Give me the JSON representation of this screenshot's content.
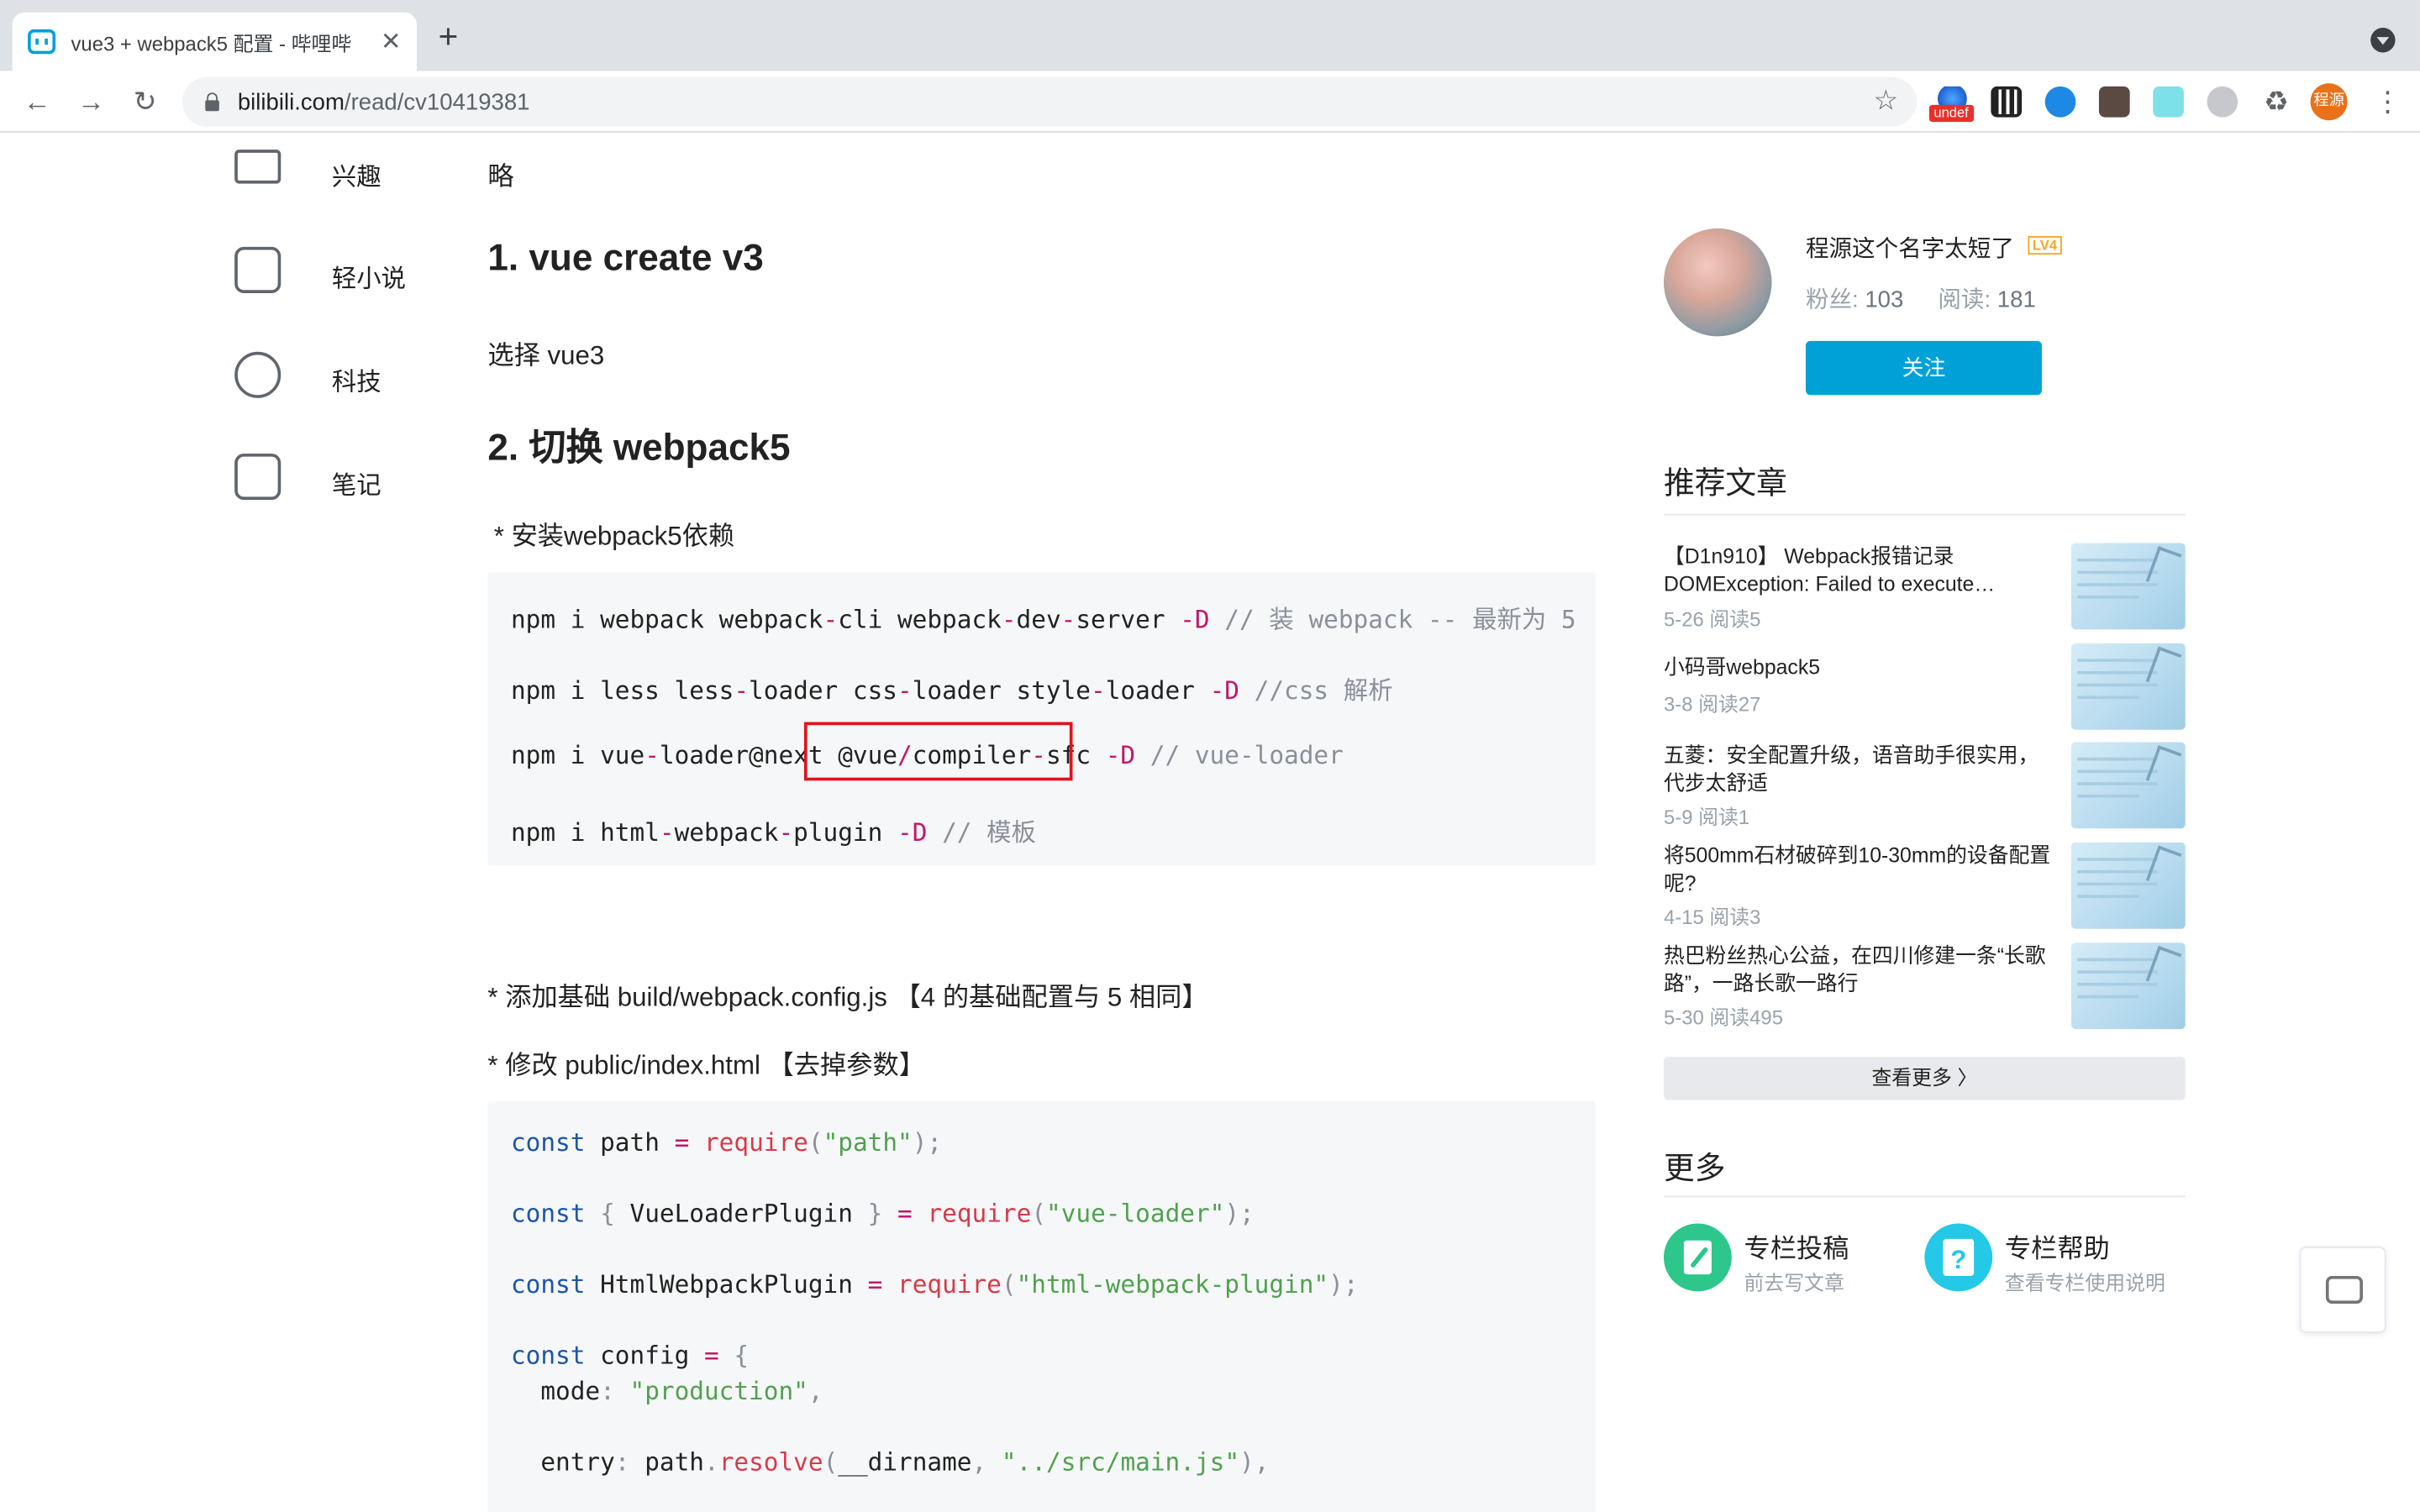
{
  "browser": {
    "tab_title": "vue3 + webpack5 配置 - 哔哩哔",
    "tab_close": "✕",
    "new_tab": "+",
    "url_host": "bilibili.com",
    "url_path": "/read/cv10419381",
    "ext_undef_label": "undef",
    "profile_label": "程源"
  },
  "left_nav": {
    "items": [
      {
        "label": "兴趣",
        "icon": "easel-icon"
      },
      {
        "label": "轻小说",
        "icon": "book-icon"
      },
      {
        "label": "科技",
        "icon": "planet-icon"
      },
      {
        "label": "笔记",
        "icon": "edit-note-icon"
      }
    ]
  },
  "article": {
    "lue": "略",
    "h_create": "1. vue create v3",
    "choose_vue3": "选择 vue3",
    "h_switch": "2. 切换 webpack5",
    "bullet_install": "*  安装webpack5依赖",
    "code1": [
      {
        "parts": [
          {
            "t": "npm i webpack webpack",
            "c": ""
          },
          {
            "t": "-",
            "c": "op"
          },
          {
            "t": "cli webpack",
            "c": ""
          },
          {
            "t": "-",
            "c": "op"
          },
          {
            "t": "dev",
            "c": ""
          },
          {
            "t": "-",
            "c": "op"
          },
          {
            "t": "server ",
            "c": ""
          },
          {
            "t": "-D",
            "c": "op"
          },
          {
            "t": " // 装 webpack -- 最新为 5",
            "c": "cm"
          }
        ]
      },
      {
        "parts": [
          {
            "t": "npm i less less",
            "c": ""
          },
          {
            "t": "-",
            "c": "op"
          },
          {
            "t": "loader css",
            "c": ""
          },
          {
            "t": "-",
            "c": "op"
          },
          {
            "t": "loader style",
            "c": ""
          },
          {
            "t": "-",
            "c": "op"
          },
          {
            "t": "loader ",
            "c": ""
          },
          {
            "t": "-D",
            "c": "op"
          },
          {
            "t": " //css 解析",
            "c": "cm"
          }
        ]
      },
      {
        "parts": [
          {
            "t": "npm i vue",
            "c": ""
          },
          {
            "t": "-",
            "c": "op"
          },
          {
            "t": "loader@next ",
            "c": ""
          },
          {
            "t": "@vue",
            "c": ""
          },
          {
            "t": "/",
            "c": "op"
          },
          {
            "t": "compiler",
            "c": ""
          },
          {
            "t": "-",
            "c": "op"
          },
          {
            "t": "sfc ",
            "c": ""
          },
          {
            "t": "-D",
            "c": "op"
          },
          {
            "t": " // vue-loader",
            "c": "cm"
          }
        ]
      },
      {
        "parts": [
          {
            "t": "npm i html",
            "c": ""
          },
          {
            "t": "-",
            "c": "op"
          },
          {
            "t": "webpack",
            "c": ""
          },
          {
            "t": "-",
            "c": "op"
          },
          {
            "t": "plugin ",
            "c": ""
          },
          {
            "t": "-D",
            "c": "op"
          },
          {
            "t": " // 模板",
            "c": "cm"
          }
        ]
      }
    ],
    "bullet_add_config": "*  添加基础 build/webpack.config.js 【4 的基础配置与 5 相同】",
    "bullet_modify_html": "*  修改 public/index.html 【去掉参数】",
    "code2": [
      {
        "parts": [
          {
            "t": "const",
            "c": "kw"
          },
          {
            "t": " path ",
            "c": ""
          },
          {
            "t": "=",
            "c": "op"
          },
          {
            "t": " ",
            "c": ""
          },
          {
            "t": "require",
            "c": "fn"
          },
          {
            "t": "(",
            "c": "pun"
          },
          {
            "t": "\"path\"",
            "c": "str"
          },
          {
            "t": ");",
            "c": "pun"
          }
        ]
      },
      {
        "parts": [
          {
            "t": "const",
            "c": "kw"
          },
          {
            "t": " ",
            "c": ""
          },
          {
            "t": "{",
            "c": "pun"
          },
          {
            "t": " VueLoaderPlugin ",
            "c": ""
          },
          {
            "t": "}",
            "c": "pun"
          },
          {
            "t": " ",
            "c": ""
          },
          {
            "t": "=",
            "c": "op"
          },
          {
            "t": " ",
            "c": ""
          },
          {
            "t": "require",
            "c": "fn"
          },
          {
            "t": "(",
            "c": "pun"
          },
          {
            "t": "\"vue-loader\"",
            "c": "str"
          },
          {
            "t": ");",
            "c": "pun"
          }
        ]
      },
      {
        "parts": [
          {
            "t": "const",
            "c": "kw"
          },
          {
            "t": " HtmlWebpackPlugin ",
            "c": ""
          },
          {
            "t": "=",
            "c": "op"
          },
          {
            "t": " ",
            "c": ""
          },
          {
            "t": "require",
            "c": "fn"
          },
          {
            "t": "(",
            "c": "pun"
          },
          {
            "t": "\"html-webpack-plugin\"",
            "c": "str"
          },
          {
            "t": ");",
            "c": "pun"
          }
        ]
      },
      {
        "parts": [
          {
            "t": "const",
            "c": "kw"
          },
          {
            "t": " config ",
            "c": ""
          },
          {
            "t": "=",
            "c": "op"
          },
          {
            "t": " ",
            "c": ""
          },
          {
            "t": "{",
            "c": "pun"
          }
        ]
      },
      {
        "parts": [
          {
            "t": "  mode",
            "c": ""
          },
          {
            "t": ":",
            "c": "pun"
          },
          {
            "t": " ",
            "c": ""
          },
          {
            "t": "\"production\"",
            "c": "str"
          },
          {
            "t": ",",
            "c": "pun"
          }
        ]
      },
      {
        "parts": [
          {
            "t": "  entry",
            "c": ""
          },
          {
            "t": ":",
            "c": "pun"
          },
          {
            "t": " path",
            "c": ""
          },
          {
            "t": ".",
            "c": "pun"
          },
          {
            "t": "resolve",
            "c": "fn"
          },
          {
            "t": "(",
            "c": "pun"
          },
          {
            "t": "__dirname",
            "c": ""
          },
          {
            "t": ",",
            "c": "pun"
          },
          {
            "t": " ",
            "c": ""
          },
          {
            "t": "\"../src/main.js\"",
            "c": "str"
          },
          {
            "t": "),",
            "c": "pun"
          }
        ]
      }
    ]
  },
  "author": {
    "name": "程源这个名字太短了",
    "level": "LV4",
    "fans_label": "粉丝:",
    "fans_value": "103",
    "reads_label": "阅读:",
    "reads_value": "181",
    "follow_label": "关注"
  },
  "recommended": {
    "title": "推荐文章",
    "items": [
      {
        "title": "【D1n910】 Webpack报错记录 DOMException: Failed to execute…",
        "meta": "5-26 阅读5"
      },
      {
        "title": "小码哥webpack5",
        "meta": "3-8 阅读27"
      },
      {
        "title": "五菱：安全配置升级，语音助手很实用，代步太舒适",
        "meta": "5-9 阅读1"
      },
      {
        "title": "将500mm石材破碎到10-30mm的设备配置呢?",
        "meta": "4-15 阅读3"
      },
      {
        "title": "热巴粉丝热心公益，在四川修建一条“长歌路”，一路长歌一路行",
        "meta": "5-30 阅读495"
      }
    ],
    "see_more": "查看更多 〉"
  },
  "more": {
    "title": "更多",
    "cards": [
      {
        "title": "专栏投稿",
        "sub": "前去写文章",
        "icon": "write-article-icon",
        "color": "#2dc68b"
      },
      {
        "title": "专栏帮助",
        "sub": "查看专栏使用说明",
        "icon": "help-icon",
        "color": "#23c9e6"
      }
    ]
  }
}
